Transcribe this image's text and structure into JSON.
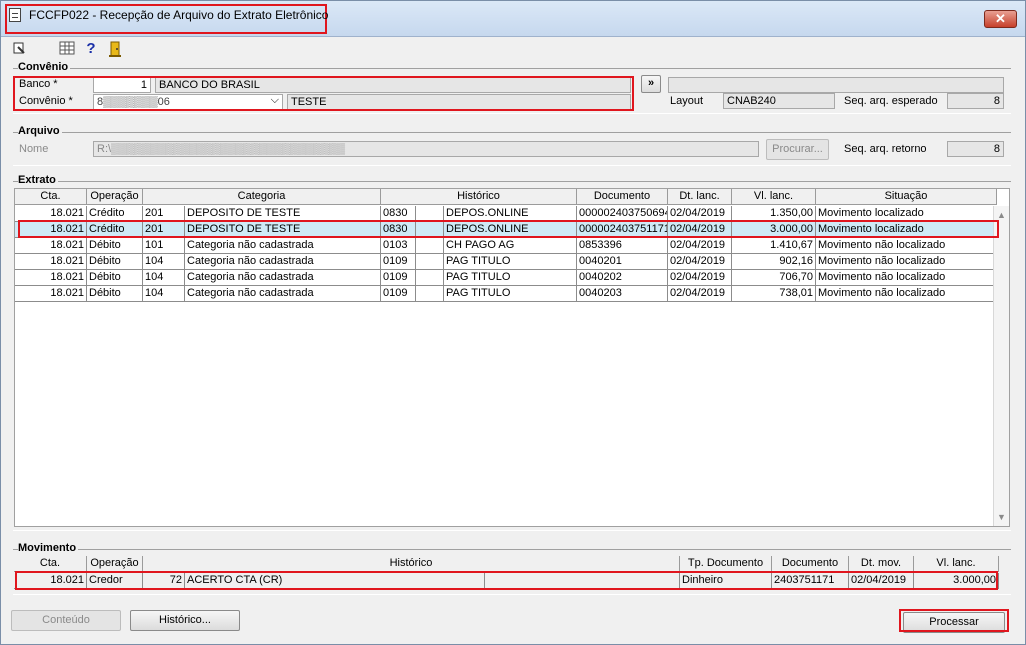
{
  "window": {
    "title": "FCCFP022 - Recepção de Arquivo do Extrato Eletrônico",
    "close_label": "✕"
  },
  "toolbar": {
    "icons": [
      "exit-icon",
      "calendar-grid-icon",
      "help-icon",
      "door-icon"
    ],
    "help_glyph": "?"
  },
  "convenio": {
    "group_label": "Convênio",
    "banco_label": "Banco *",
    "banco_code": "1",
    "banco_name": "BANCO DO BRASIL",
    "convenio_label": "Convênio *",
    "convenio_value": "8▒▒▒▒▒▒▒06",
    "convenio_desc": "TESTE",
    "expand_label": "»",
    "layout_label": "Layout",
    "layout_value": "CNAB240",
    "seq_esperado_label": "Seq. arq. esperado",
    "seq_esperado_value": "8"
  },
  "arquivo": {
    "group_label": "Arquivo",
    "nome_label": "Nome",
    "nome_value": "R:\\▒▒▒▒▒▒▒▒▒▒▒▒▒▒▒▒▒▒▒▒▒▒▒▒▒▒▒▒▒▒",
    "procurar_label": "Procurar...",
    "seq_retorno_label": "Seq. arq. retorno",
    "seq_retorno_value": "8"
  },
  "extrato": {
    "group_label": "Extrato",
    "columns": [
      "Cta.",
      "Operação",
      "Categoria",
      "Histórico",
      "Documento",
      "Dt. lanc.",
      "Vl. lanc.",
      "Situação"
    ],
    "rows": [
      {
        "cta": "18.021",
        "operacao": "Crédito",
        "cat_cod": "201",
        "categoria": "DEPOSITO DE TESTE",
        "hist_cod": "0830",
        "historico": "DEPOS.ONLINE",
        "documento": "000002403750694",
        "dt_lanc": "02/04/2019",
        "vl_lanc": "1.350,00",
        "situacao": "Movimento localizado"
      },
      {
        "cta": "18.021",
        "operacao": "Crédito",
        "cat_cod": "201",
        "categoria": "DEPOSITO DE TESTE",
        "hist_cod": "0830",
        "historico": "DEPOS.ONLINE",
        "documento": "000002403751171",
        "dt_lanc": "02/04/2019",
        "vl_lanc": "3.000,00",
        "situacao": "Movimento localizado"
      },
      {
        "cta": "18.021",
        "operacao": "Débito",
        "cat_cod": "101",
        "categoria": "Categoria não cadastrada",
        "hist_cod": "0103",
        "historico": "CH PAGO AG",
        "documento": "0853396",
        "dt_lanc": "02/04/2019",
        "vl_lanc": "1.410,67",
        "situacao": "Movimento não localizado"
      },
      {
        "cta": "18.021",
        "operacao": "Débito",
        "cat_cod": "104",
        "categoria": "Categoria não cadastrada",
        "hist_cod": "0109",
        "historico": "PAG TITULO",
        "documento": "0040201",
        "dt_lanc": "02/04/2019",
        "vl_lanc": "902,16",
        "situacao": "Movimento não localizado"
      },
      {
        "cta": "18.021",
        "operacao": "Débito",
        "cat_cod": "104",
        "categoria": "Categoria não cadastrada",
        "hist_cod": "0109",
        "historico": "PAG TITULO",
        "documento": "0040202",
        "dt_lanc": "02/04/2019",
        "vl_lanc": "706,70",
        "situacao": "Movimento não localizado"
      },
      {
        "cta": "18.021",
        "operacao": "Débito",
        "cat_cod": "104",
        "categoria": "Categoria não cadastrada",
        "hist_cod": "0109",
        "historico": "PAG TITULO",
        "documento": "0040203",
        "dt_lanc": "02/04/2019",
        "vl_lanc": "738,01",
        "situacao": "Movimento não localizado"
      }
    ]
  },
  "movimento": {
    "group_label": "Movimento",
    "columns": [
      "Cta.",
      "Operação",
      "Histórico",
      "Tp. Documento",
      "Documento",
      "Dt. mov.",
      "Vl. lanc."
    ],
    "row": {
      "cta": "18.021",
      "operacao": "Credor",
      "hist_cod": "72",
      "historico": "ACERTO CTA (CR)",
      "tp_documento": "Dinheiro",
      "documento": "2403751171",
      "dt_mov": "02/04/2019",
      "vl_lanc": "3.000,00"
    }
  },
  "footer": {
    "conteudo_label": "Conteúdo",
    "historico_label": "Histórico...",
    "processar_label": "Processar"
  },
  "colors": {
    "highlight": "#e0161e",
    "selected_row": "#cfeaf6"
  }
}
